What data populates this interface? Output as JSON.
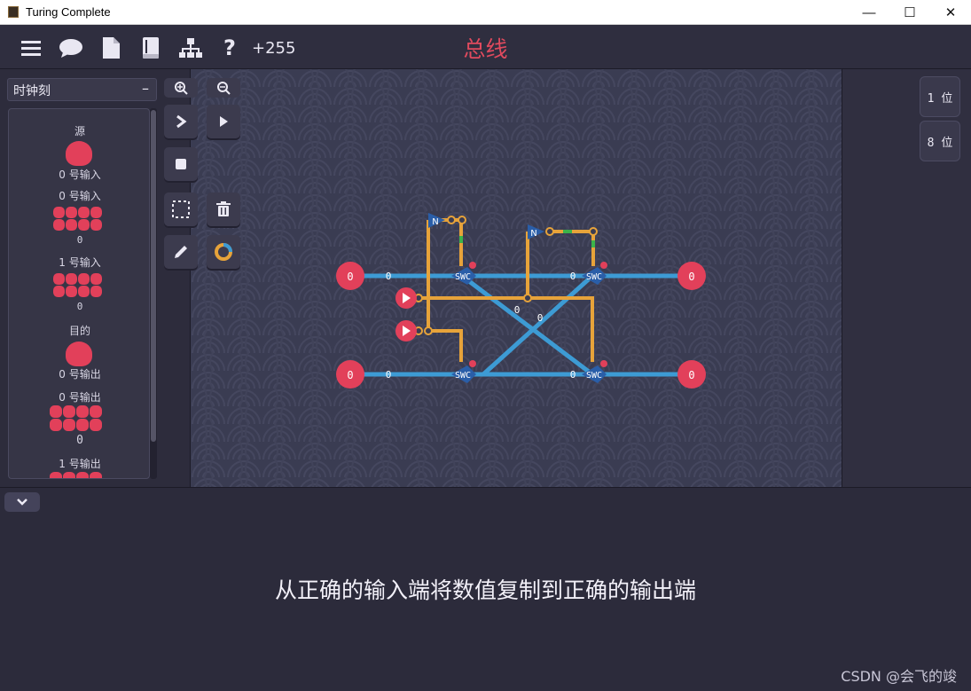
{
  "window": {
    "title": "Turing Complete"
  },
  "toolbar": {
    "score": "+255",
    "level_title": "总线",
    "icons": [
      "menu-icon",
      "chat-icon",
      "document-icon",
      "book-icon",
      "hierarchy-icon",
      "help-icon"
    ]
  },
  "sidebar": {
    "dropdown": "时钟刻",
    "components": {
      "source_header": "源",
      "input0_label": "0 号输入",
      "input0_bus_label": "0 号输入",
      "input0_bus_value": "0",
      "input1_bus_label": "1 号输入",
      "input1_bus_value": "0",
      "dest_header": "目的",
      "output0_label": "0 号输出",
      "output0_bus_label": "0 号输出",
      "output0_bus_value": "0",
      "output1_bus_label": "1 号输出"
    }
  },
  "tools": [
    "zoom-in",
    "zoom-out",
    "step",
    "run",
    "stop",
    "select",
    "delete",
    "draw",
    "color"
  ],
  "circuit": {
    "left_inputs": [
      "0",
      "0"
    ],
    "right_outputs": [
      "0",
      "0"
    ],
    "switch_label": "SWC",
    "not_label": "N",
    "wire_value": "0",
    "colors": {
      "bus": "#3d9bd4",
      "ctrl": "#e7a33a",
      "pin": "#e2405a",
      "not": "#2a5ea8"
    }
  },
  "right_panel": {
    "bit1": "1 位",
    "bit8": "8 位"
  },
  "bottom": {
    "description": "从正确的输入端将数值复制到正确的输出端",
    "watermark": "CSDN @会飞的竣"
  }
}
